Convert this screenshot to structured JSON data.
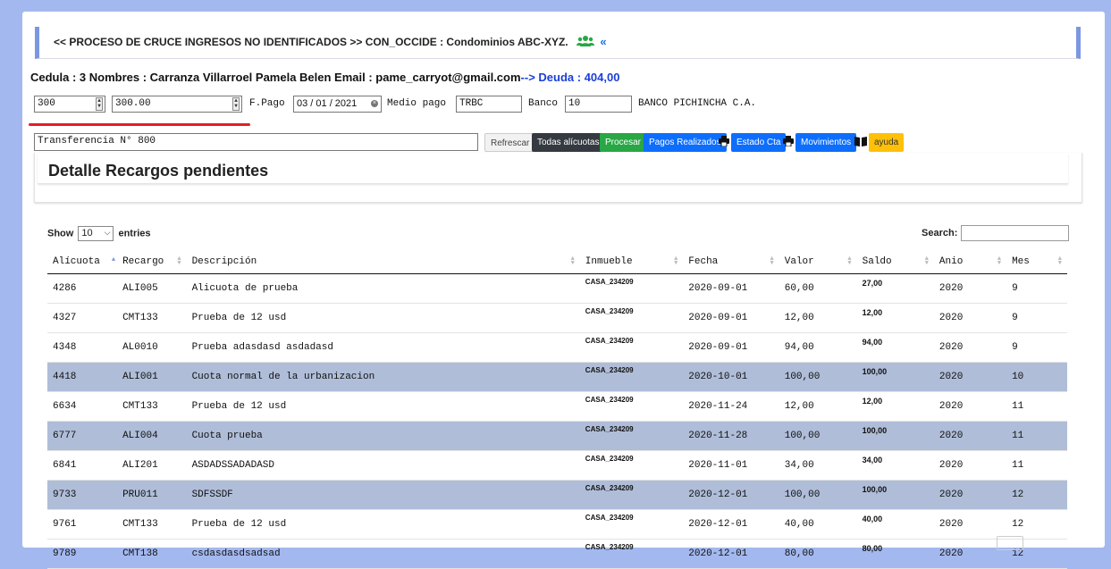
{
  "banner": {
    "title": "<< PROCESO DE CRUCE INGRESOS NO IDENTIFICADOS >> CON_OCCIDE : Condominios ABC-XYZ.",
    "chevron": "«"
  },
  "info": {
    "text": "Cedula : 3 Nombres : Carranza Villarroel Pamela Belen Email : pame_carryot@gmail.com",
    "arrow": "-->",
    "deuda": " Deuda : 404,00"
  },
  "form": {
    "num1": "300",
    "num2": "300.00",
    "fpago_label": "F.Pago",
    "fecha": "03 / 01 / 2021",
    "medio_label": "Medio pago",
    "medio_value": "TRBC",
    "banco_label": "Banco",
    "banco_value": "10",
    "banco_name": "BANCO PICHINCHA C.A.",
    "transfer_value": "Transferencia N° 800"
  },
  "toolbar": {
    "refrescar": "Refrescar",
    "todas": "Todas alícuotas",
    "procesar": "Procesar",
    "pagos": "Pagos Realizados",
    "estado": "Estado Cta",
    "movimientos": "Movimientos",
    "ayuda": "ayuda"
  },
  "panel": {
    "title": "Detalle Recargos pendientes"
  },
  "table_controls": {
    "show": "Show",
    "entries_value": "10",
    "entries": "entries",
    "search": "Search:"
  },
  "columns": [
    "Alícuota",
    "Recargo",
    "Descripción",
    "Inmueble",
    "Fecha",
    "Valor",
    "Saldo",
    "Anio",
    "Mes"
  ],
  "rows": [
    {
      "alicuota": "4286",
      "recargo": "ALI005",
      "descripcion": "Alicuota de prueba",
      "inmueble": "CASA_234209",
      "fecha": "2020-09-01",
      "valor": "60,00",
      "saldo": "27,00",
      "anio": "2020",
      "mes": "9",
      "highlight": false
    },
    {
      "alicuota": "4327",
      "recargo": "CMT133",
      "descripcion": "Prueba de 12 usd",
      "inmueble": "CASA_234209",
      "fecha": "2020-09-01",
      "valor": "12,00",
      "saldo": "12,00",
      "anio": "2020",
      "mes": "9",
      "highlight": false
    },
    {
      "alicuota": "4348",
      "recargo": "AL0010",
      "descripcion": "Prueba adasdasd asdadasd",
      "inmueble": "CASA_234209",
      "fecha": "2020-09-01",
      "valor": "94,00",
      "saldo": "94,00",
      "anio": "2020",
      "mes": "9",
      "highlight": false
    },
    {
      "alicuota": "4418",
      "recargo": "ALI001",
      "descripcion": "Cuota normal de la urbanizacion",
      "inmueble": "CASA_234209",
      "fecha": "2020-10-01",
      "valor": "100,00",
      "saldo": "100,00",
      "anio": "2020",
      "mes": "10",
      "highlight": true
    },
    {
      "alicuota": "6634",
      "recargo": "CMT133",
      "descripcion": "Prueba de 12 usd",
      "inmueble": "CASA_234209",
      "fecha": "2020-11-24",
      "valor": "12,00",
      "saldo": "12,00",
      "anio": "2020",
      "mes": "11",
      "highlight": false
    },
    {
      "alicuota": "6777",
      "recargo": "ALI004",
      "descripcion": "Cuota prueba",
      "inmueble": "CASA_234209",
      "fecha": "2020-11-28",
      "valor": "100,00",
      "saldo": "100,00",
      "anio": "2020",
      "mes": "11",
      "highlight": true
    },
    {
      "alicuota": "6841",
      "recargo": "ALI201",
      "descripcion": "ASDADSSADADASD",
      "inmueble": "CASA_234209",
      "fecha": "2020-11-01",
      "valor": "34,00",
      "saldo": "34,00",
      "anio": "2020",
      "mes": "11",
      "highlight": false
    },
    {
      "alicuota": "9733",
      "recargo": "PRU011",
      "descripcion": "SDFSSDF",
      "inmueble": "CASA_234209",
      "fecha": "2020-12-01",
      "valor": "100,00",
      "saldo": "100,00",
      "anio": "2020",
      "mes": "12",
      "highlight": true
    },
    {
      "alicuota": "9761",
      "recargo": "CMT133",
      "descripcion": "Prueba de 12 usd",
      "inmueble": "CASA_234209",
      "fecha": "2020-12-01",
      "valor": "40,00",
      "saldo": "40,00",
      "anio": "2020",
      "mes": "12",
      "highlight": false
    },
    {
      "alicuota": "9789",
      "recargo": "CMT138",
      "descripcion": "csdasdasdsadsad",
      "inmueble": "CASA_234209",
      "fecha": "2020-12-01",
      "valor": "80,00",
      "saldo": "80,00",
      "anio": "2020",
      "mes": "12",
      "highlight": false
    }
  ]
}
